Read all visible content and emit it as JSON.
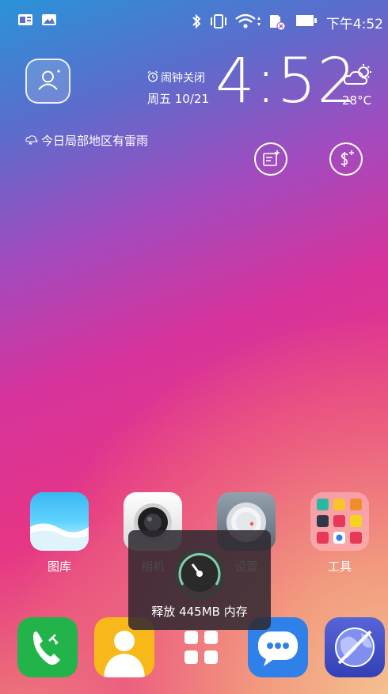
{
  "statusbar": {
    "time": "下午4:52"
  },
  "widget": {
    "alarm": "闹钟关闭",
    "date": "周五  10/21",
    "time": "4:52",
    "temperature": "28°C",
    "forecast": "今日局部地区有雷雨"
  },
  "apps": [
    {
      "label": "图库",
      "icon": "gallery-icon"
    },
    {
      "label": "相机",
      "icon": "camera-icon"
    },
    {
      "label": "设置",
      "icon": "settings-icon"
    },
    {
      "label": "工具",
      "icon": "tools-folder-icon"
    }
  ],
  "toast": {
    "message": "释放 445MB 内存"
  },
  "dock": [
    {
      "icon": "phone-icon"
    },
    {
      "icon": "contacts-icon"
    },
    {
      "icon": "all-apps-icon"
    },
    {
      "icon": "messages-icon"
    },
    {
      "icon": "browser-icon"
    }
  ],
  "colors": {
    "phone": "#22b34a",
    "contacts": "#f9b81a",
    "messages": "#2f80e8",
    "browser": "#3f4fc6"
  }
}
